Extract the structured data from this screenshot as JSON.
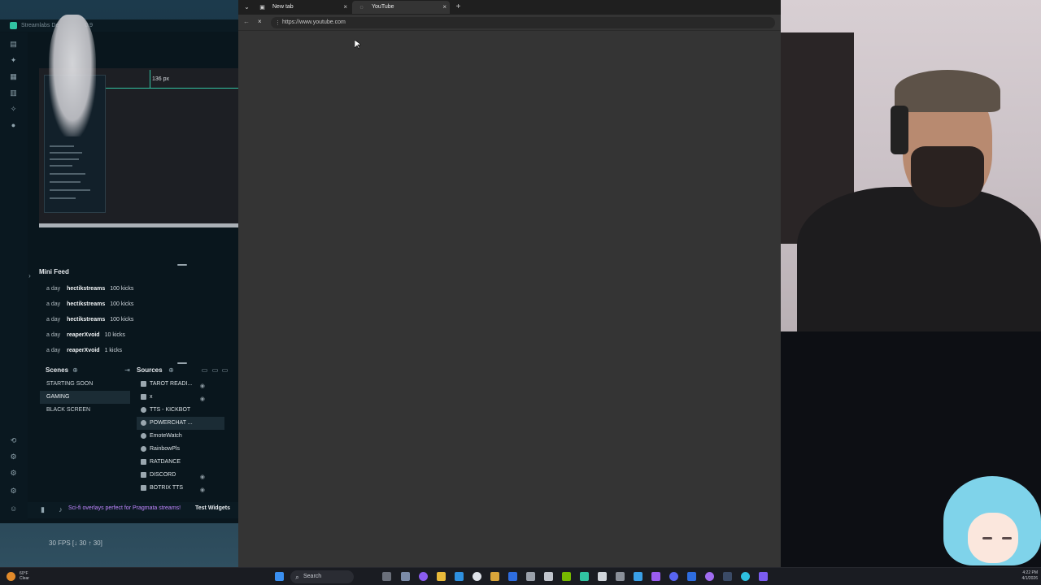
{
  "streamlabs": {
    "title": "Streamlabs De",
    "version": "0.9",
    "preview": {
      "guide_label": "136 px"
    },
    "mini_feed": {
      "title": "Mini Feed",
      "items": [
        {
          "time": "a day",
          "name": "hectikstreams",
          "amount": "100 kicks"
        },
        {
          "time": "a day",
          "name": "hectikstreams",
          "amount": "100 kicks"
        },
        {
          "time": "a day",
          "name": "hectikstreams",
          "amount": "100 kicks"
        },
        {
          "time": "a day",
          "name": "reaperXvoid",
          "amount": "10 kicks"
        },
        {
          "time": "a day",
          "name": "reaperXvoid",
          "amount": "1 kicks"
        }
      ]
    },
    "scenes": {
      "title": "Scenes",
      "items": [
        "STARTING SOON",
        "GAMING",
        "BLACK SCREEN"
      ],
      "active_index": 1
    },
    "sources": {
      "title": "Sources",
      "items": [
        "TAROT READI...",
        "x",
        "TTS - KICKBOT",
        "POWERCHAT ...",
        "EmoteWatch",
        "RainbowPls",
        "RATDANCE",
        "DISCORD",
        "BOTRIX TTS"
      ],
      "active_index": 3
    },
    "promo": "Sci-fi overlays perfect for Pragmata streams!",
    "test_widgets": "Test Widgets",
    "fps": "30 FPS [↓ 30 ↑ 30]"
  },
  "browser": {
    "tabs": [
      {
        "label": "New tab"
      },
      {
        "label": "YouTube"
      }
    ],
    "active_tab_index": 1,
    "url": "https://www.youtube.com"
  },
  "taskbar": {
    "search_placeholder": "Search",
    "weather": [
      "60°F",
      "Clear"
    ],
    "clock": [
      "4:22 PM",
      "4/1/2026"
    ]
  },
  "colors": {
    "accent": "#31c3a2",
    "promo": "#c086ff",
    "browser_bg": "#343434"
  }
}
